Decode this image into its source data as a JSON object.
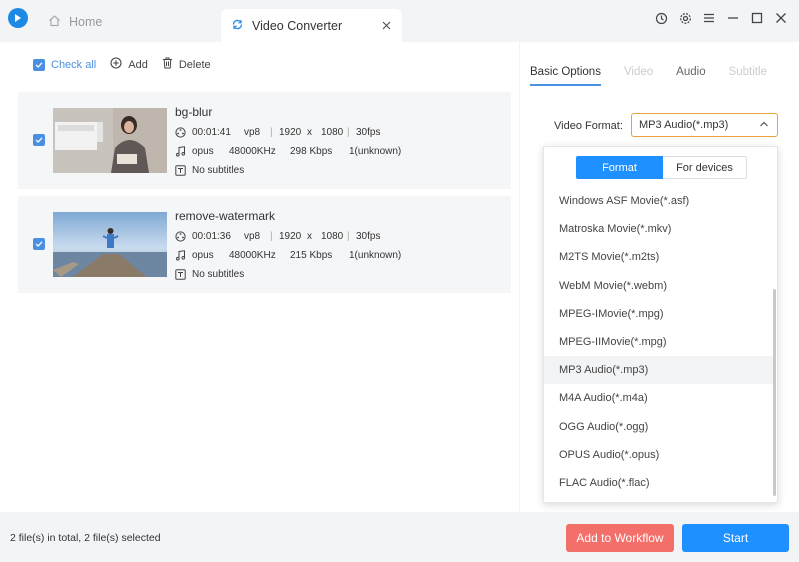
{
  "titlebar": {
    "home_label": "Home",
    "active_tab_label": "Video Converter",
    "icons": [
      "history-icon",
      "settings-icon",
      "menu-icon",
      "minimize-icon",
      "maximize-icon",
      "close-icon"
    ]
  },
  "toolbar": {
    "check_all": "Check all",
    "add": "Add",
    "delete": "Delete"
  },
  "files": [
    {
      "name": "bg-blur",
      "duration": "00:01:41",
      "vcodec": "vp8",
      "width": "1920",
      "x": "x",
      "height": "1080",
      "fps": "30fps",
      "acodec": "opus",
      "samplerate": "48000KHz",
      "bitrate": "298 Kbps",
      "channels": "1(unknown)",
      "subtitles": "No subtitles"
    },
    {
      "name": "remove-watermark",
      "duration": "00:01:36",
      "vcodec": "vp8",
      "width": "1920",
      "x": "x",
      "height": "1080",
      "fps": "30fps",
      "acodec": "opus",
      "samplerate": "48000KHz",
      "bitrate": "215 Kbps",
      "channels": "1(unknown)",
      "subtitles": "No subtitles"
    }
  ],
  "options": {
    "tabs": [
      "Basic Options",
      "Video",
      "Audio",
      "Subtitle"
    ],
    "video_format_label": "Video Format:",
    "video_format_value": "MP3 Audio(*.mp3)"
  },
  "dropdown": {
    "toggle_format": "Format",
    "toggle_devices": "For devices",
    "items": [
      "Windows ASF Movie(*.asf)",
      "Matroska Movie(*.mkv)",
      "M2TS Movie(*.m2ts)",
      "WebM Movie(*.webm)",
      "MPEG-IMovie(*.mpg)",
      "MPEG-IIMovie(*.mpg)",
      "MP3 Audio(*.mp3)",
      "M4A Audio(*.m4a)",
      "OGG Audio(*.ogg)",
      "OPUS Audio(*.opus)",
      "FLAC Audio(*.flac)"
    ],
    "selected_index": 6
  },
  "bottom": {
    "status": "2 file(s) in total, 2 file(s) selected",
    "add_to_workflow": "Add to Workflow",
    "start": "Start"
  },
  "colors": {
    "accent": "#1e90ff",
    "workflow": "#f36f6a",
    "select_border": "#e8a23a"
  }
}
